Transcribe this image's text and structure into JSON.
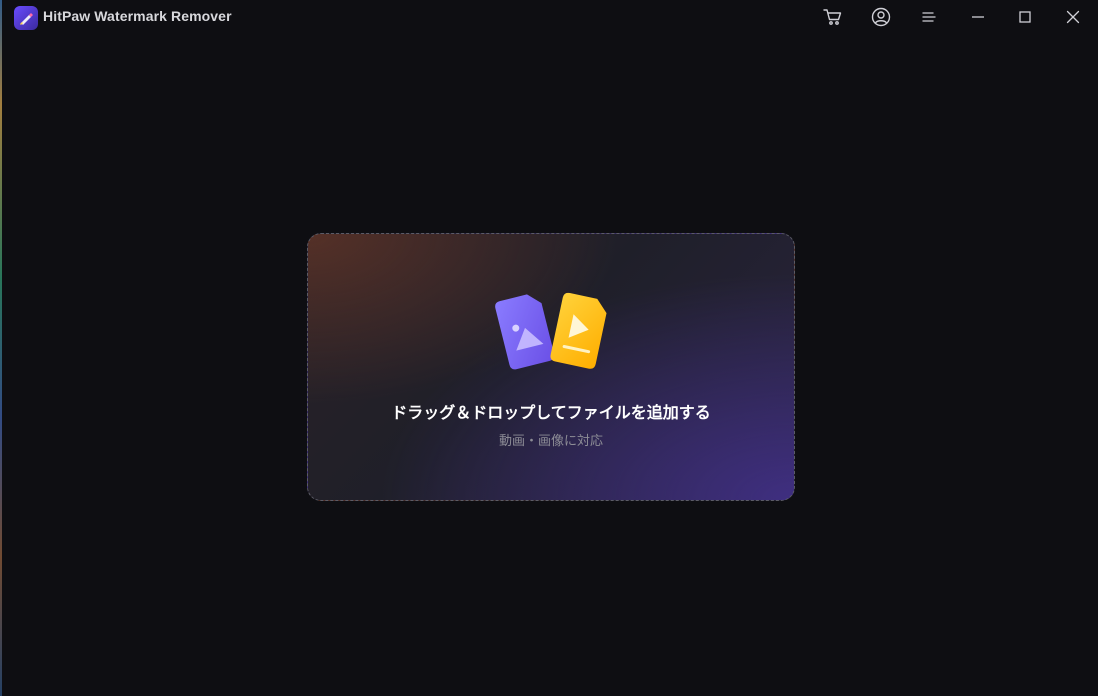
{
  "app": {
    "title": "HitPaw Watermark Remover"
  },
  "titlebar": {
    "icons": [
      "cart-icon",
      "account-icon",
      "menu-icon",
      "minimize-icon",
      "maximize-icon",
      "close-icon"
    ]
  },
  "dropzone": {
    "title": "ドラッグ＆ドロップしてファイルを追加する",
    "subtitle": "動画・画像に対応"
  },
  "colors": {
    "background": "#0e0e12",
    "brand_purple": "#6a4cff",
    "image_card": "#7b6cf6",
    "video_card": "#ffc21a",
    "dashed_border": "#5b5b66",
    "subtitle_text": "#8d8d96"
  }
}
